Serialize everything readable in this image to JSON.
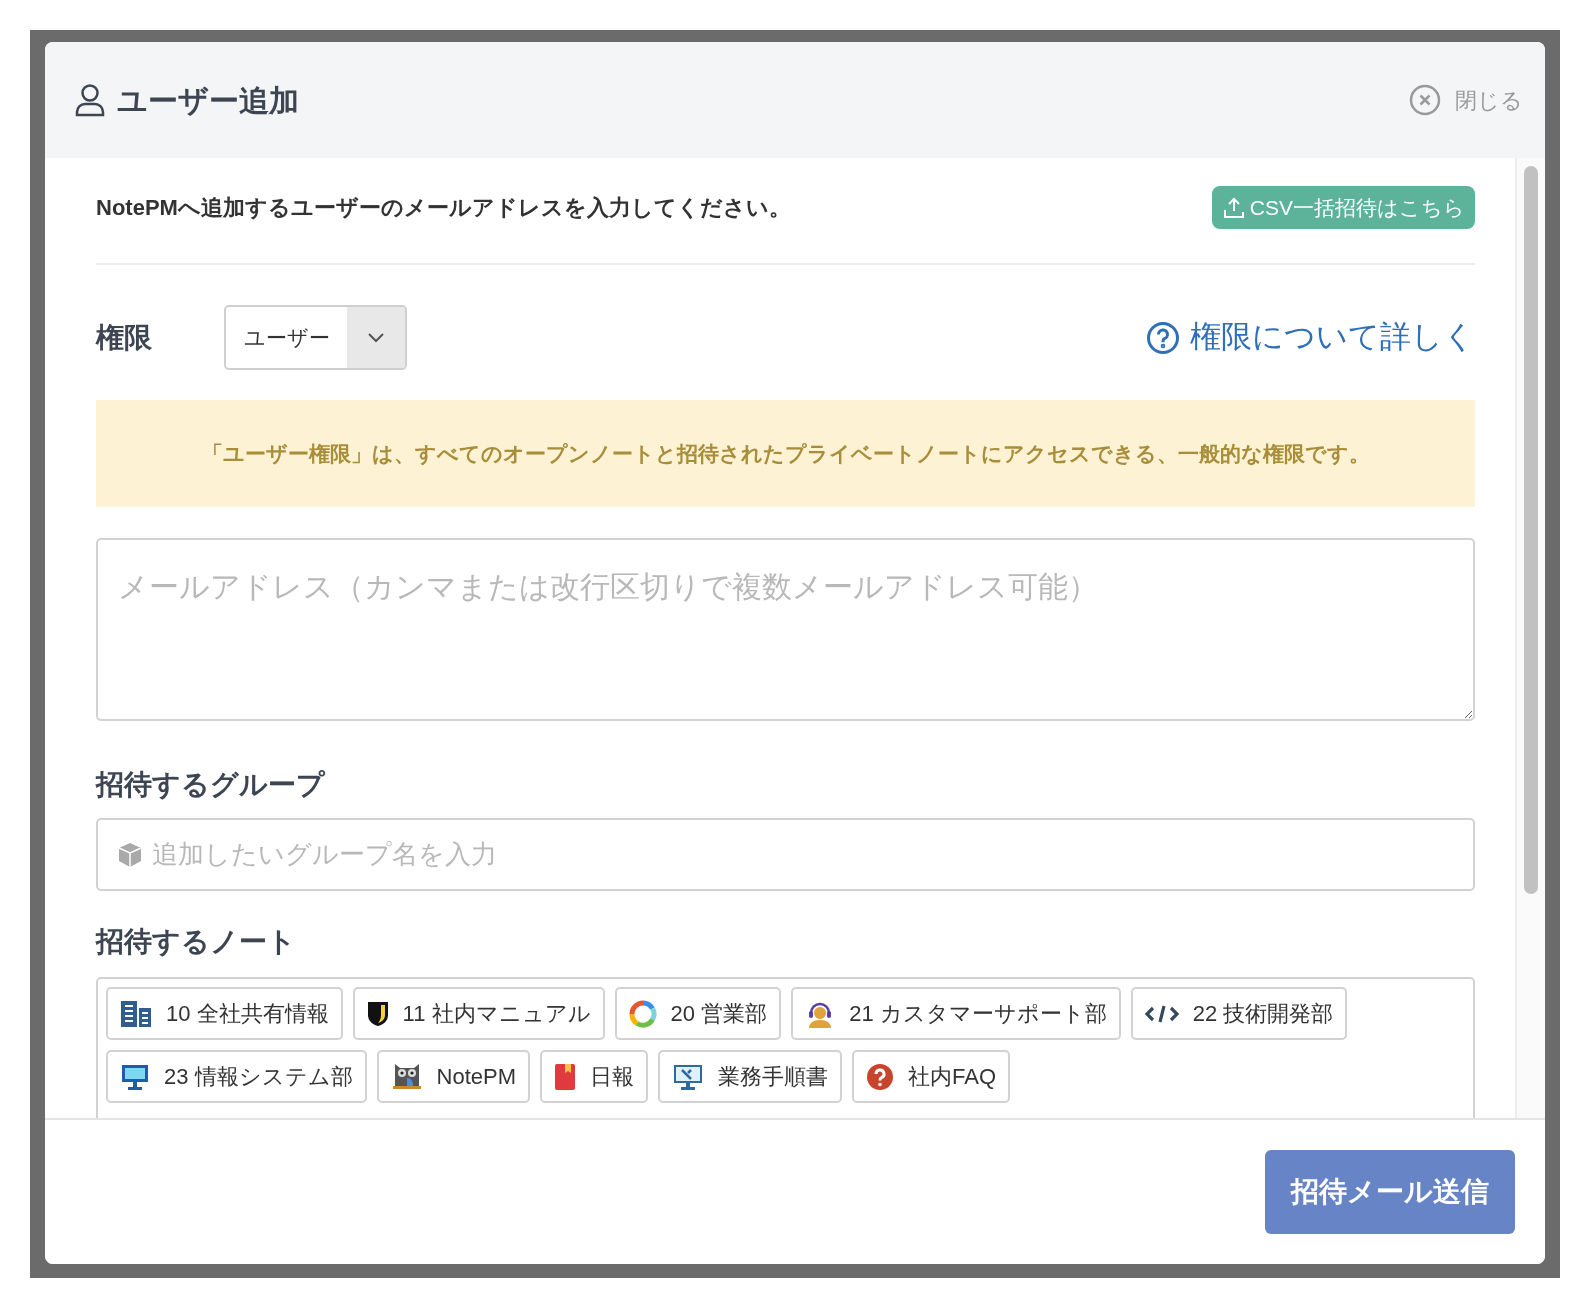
{
  "dialog": {
    "title": "ユーザー追加",
    "close_label": "閉じる"
  },
  "intro": "NotePMへ追加するユーザーのメールアドレスを入力してください。",
  "csv_button": "CSV一括招待はこちら",
  "role": {
    "label": "権限",
    "value": "ユーザー",
    "help_link": "権限について詳しく"
  },
  "notice": "「ユーザー権限」は、すべてのオープンノートと招待されたプライベートノートにアクセスできる、一般的な権限です。",
  "email_field": {
    "placeholder": "メールアドレス（カンマまたは改行区切りで複数メールアドレス可能）"
  },
  "groups": {
    "heading": "招待するグループ",
    "placeholder": "追加したいグループ名を入力"
  },
  "notes": {
    "heading": "招待するノート",
    "items": [
      {
        "label": "10 全社共有情報"
      },
      {
        "label": "11 社内マニュアル"
      },
      {
        "label": "20 営業部"
      },
      {
        "label": "21 カスタマーサポート部"
      },
      {
        "label": "22 技術開発部"
      },
      {
        "label": "23 情報システム部"
      },
      {
        "label": "NotePM"
      },
      {
        "label": "日報"
      },
      {
        "label": "業務手順書"
      },
      {
        "label": "社内FAQ"
      }
    ]
  },
  "submit_button": "招待メール送信"
}
